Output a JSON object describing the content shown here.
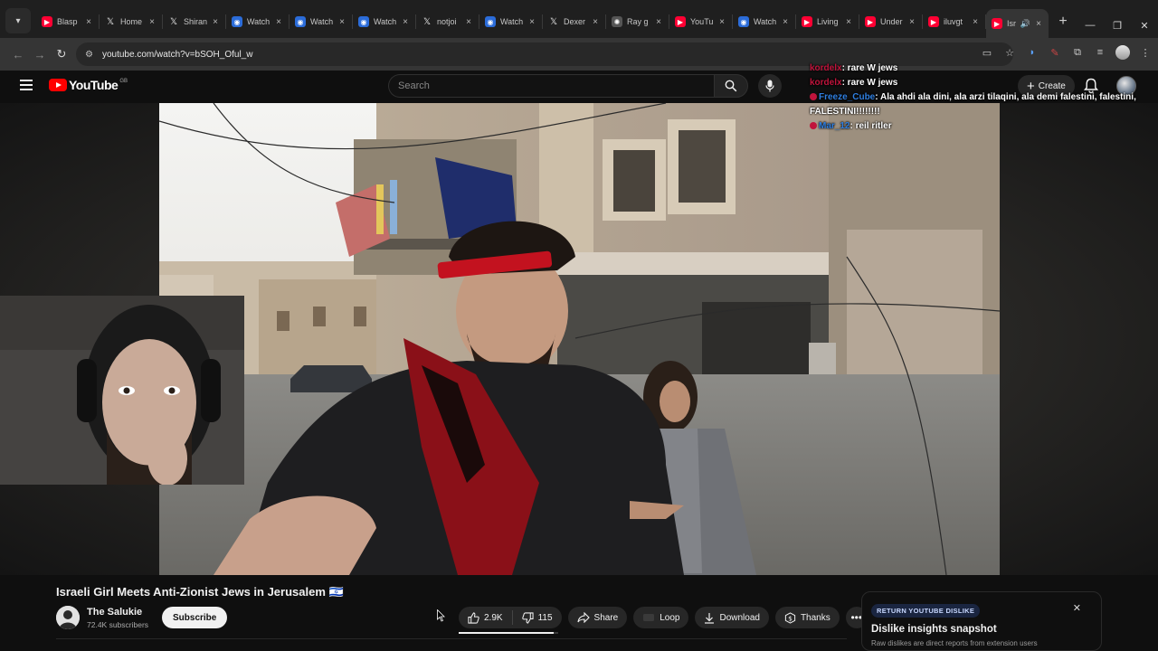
{
  "browser": {
    "tabs": [
      {
        "label": "Blasp",
        "icon": "youtube-icon",
        "color": "#ff0033"
      },
      {
        "label": "Home",
        "icon": "x-icon",
        "color": "#000000"
      },
      {
        "label": "Shiran",
        "icon": "x-icon",
        "color": "#000000"
      },
      {
        "label": "Watch",
        "icon": "watch-icon",
        "color": "#2b6cd9"
      },
      {
        "label": "Watch",
        "icon": "watch-icon",
        "color": "#2b6cd9"
      },
      {
        "label": "Watch",
        "icon": "watch-icon",
        "color": "#2b6cd9"
      },
      {
        "label": "notjoi",
        "icon": "x-icon",
        "color": "#000000"
      },
      {
        "label": "Watch",
        "icon": "watch-icon",
        "color": "#2b6cd9"
      },
      {
        "label": "Dexer",
        "icon": "x-icon",
        "color": "#000000"
      },
      {
        "label": "Ray g",
        "icon": "openai-icon",
        "color": "#555555"
      },
      {
        "label": "YouTu",
        "icon": "youtube-icon",
        "color": "#ff0033"
      },
      {
        "label": "Watch",
        "icon": "watch-icon",
        "color": "#2b6cd9"
      },
      {
        "label": "Living",
        "icon": "youtube-icon",
        "color": "#ff0033"
      },
      {
        "label": "Under",
        "icon": "youtube-icon",
        "color": "#ff0033"
      },
      {
        "label": "iluvgt",
        "icon": "youtube-icon",
        "color": "#ff0033"
      },
      {
        "label": "Isr",
        "icon": "youtube-icon",
        "color": "#ff0033",
        "active": true
      }
    ],
    "url": "youtube.com/watch?v=bSOH_Oful_w"
  },
  "yt": {
    "logo": "YouTube",
    "region": "GB",
    "search_placeholder": "Search",
    "create_label": "Create"
  },
  "chat": [
    {
      "user": "kordelx",
      "msg": ": rare W jews"
    },
    {
      "user": "kordelx",
      "msg": ": rare W jews"
    },
    {
      "user": "Freeze_Cube",
      "msg": ": Ala ahdi ala dini, ala arzi tilaqini, ala demi falestini, falestini, FALESTINI!!!!!!!!"
    },
    {
      "user": "Mar_12",
      "msg": ": reil ritler"
    }
  ],
  "video": {
    "title": "Israeli Girl Meets Anti-Zionist Jews in Jerusalem 🇮🇱",
    "channel": "The Salukie",
    "subscribers": "72.4K subscribers",
    "subscribe_label": "Subscribe",
    "likes": "2.9K",
    "dislikes": "115",
    "like_ratio": 0.95,
    "share_label": "Share",
    "loop_label": "Loop",
    "download_label": "Download",
    "thanks_label": "Thanks"
  },
  "ryd": {
    "tag": "RETURN YOUTUBE DISLIKE",
    "heading": "Dislike insights snapshot",
    "sub": "Raw dislikes are direct reports from extension users"
  }
}
